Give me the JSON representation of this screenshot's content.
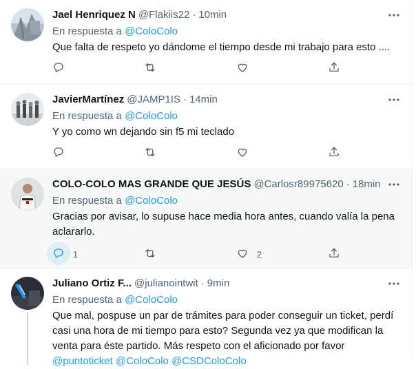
{
  "tweets": [
    {
      "name": "Jael Henriquez N",
      "handle": "@Flakiis22",
      "dot": "·",
      "time": "10min",
      "reply_prefix": "En respuesta a",
      "reply_mention": "@ColoColo",
      "text": "Que falta de respeto yo dándome el tiempo desde mi trabajo para esto ....",
      "replies": "",
      "retweets": "",
      "likes": ""
    },
    {
      "name": "JavierMartínez",
      "handle": "@JAMP1IS",
      "dot": "·",
      "time": "14min",
      "reply_prefix": "En respuesta a",
      "reply_mention": "@ColoColo",
      "text": "Y yo como wn dejando sin f5 mi teclado",
      "replies": "",
      "retweets": "",
      "likes": ""
    },
    {
      "name": "COLO-COLO MAS GRANDE QUE JESÚS",
      "handle": "@Carlosr89975620",
      "dot": "·",
      "time": "18min",
      "reply_prefix": "En respuesta a",
      "reply_mention": "@ColoColo",
      "text_line1": "Gracias por avisar, lo supuse hace media hora antes, cuando valía la pena",
      "text_line2": "aclararlo.",
      "replies": "1",
      "retweets": "",
      "likes": "2"
    },
    {
      "name": "Juliano Ortiz F...",
      "handle": "@julianointwit",
      "dot": "·",
      "time": "9min",
      "reply_prefix": "En respuesta a",
      "reply_mention": "@ColoColo",
      "text_line1": "Que mal, pospuse un par de trámites para poder conseguir un ticket, perdí",
      "text_line2": "casi una hora de mi tiempo para esto? Segunda vez ya que modifican la",
      "text_line3": "venta para éste partido. Más respeto con el aficionado por favor",
      "links": [
        "@puntoticket",
        "@ColoColo",
        "@CSDColoColo"
      ]
    }
  ],
  "colors": {
    "accent": "#1d9bf0",
    "muted": "#536471",
    "text": "#0f1419",
    "border": "#eff3f4"
  },
  "icons": [
    "more-icon",
    "reply-icon",
    "retweet-icon",
    "like-icon",
    "share-icon"
  ]
}
